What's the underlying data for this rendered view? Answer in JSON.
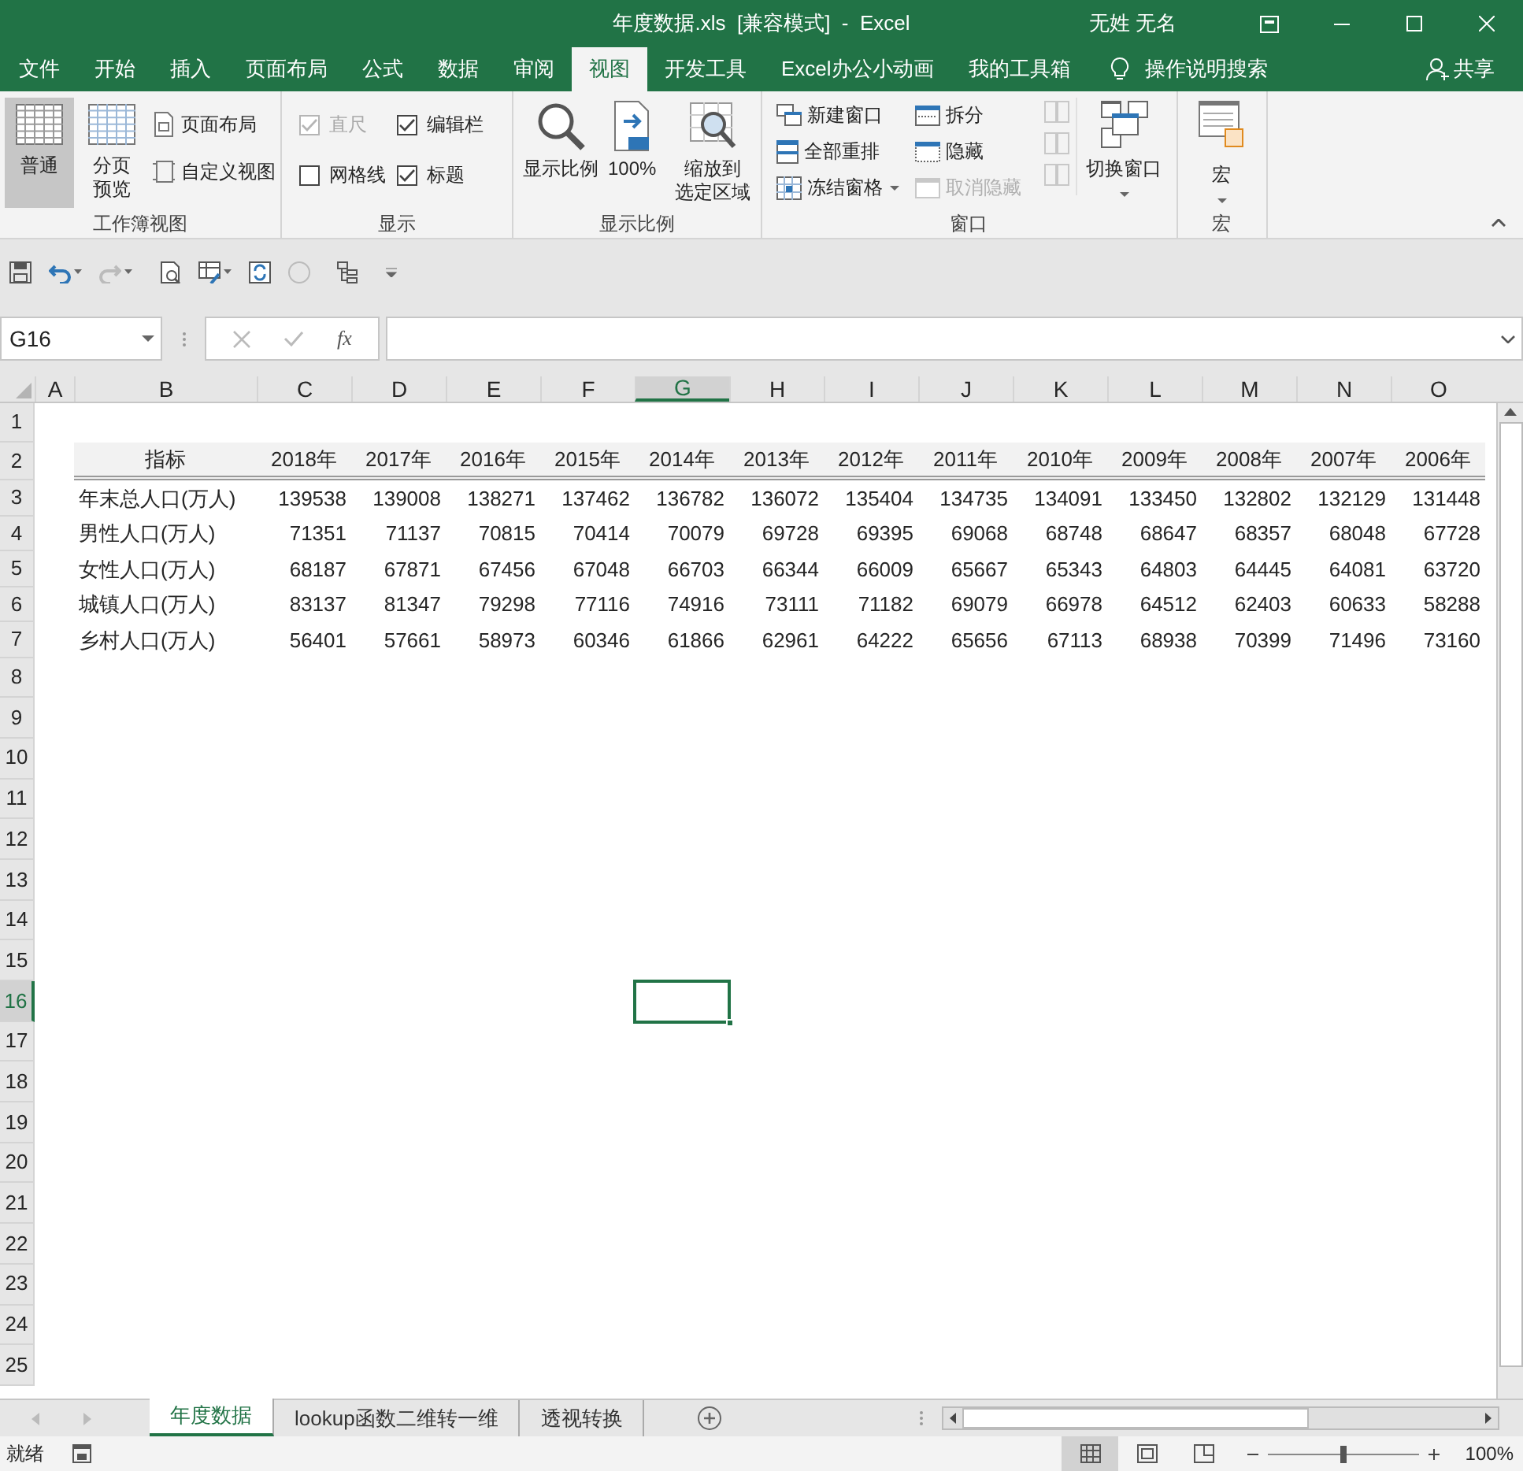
{
  "window": {
    "title": "年度数据.xls  [兼容模式]  -  Excel",
    "user": "无姓 无名"
  },
  "ribbon_tabs": [
    {
      "label": "文件",
      "selected": false
    },
    {
      "label": "开始",
      "selected": false
    },
    {
      "label": "插入",
      "selected": false
    },
    {
      "label": "页面布局",
      "selected": false
    },
    {
      "label": "公式",
      "selected": false
    },
    {
      "label": "数据",
      "selected": false
    },
    {
      "label": "审阅",
      "selected": false
    },
    {
      "label": "视图",
      "selected": true
    },
    {
      "label": "开发工具",
      "selected": false
    },
    {
      "label": "Excel办公小动画",
      "selected": false
    },
    {
      "label": "我的工具箱",
      "selected": false
    }
  ],
  "tell_me": "操作说明搜索",
  "share": "共享",
  "ribbon": {
    "workbook_views": {
      "label": "工作簿视图",
      "large": [
        {
          "lines": [
            "普通"
          ],
          "selected": true
        },
        {
          "lines": [
            "分页",
            "预览"
          ],
          "selected": false
        }
      ],
      "small": [
        "页面布局",
        "自定义视图"
      ]
    },
    "show": {
      "label": "显示",
      "checkboxes": [
        {
          "label": "直尺",
          "checked": true,
          "disabled": true
        },
        {
          "label": "编辑栏",
          "checked": true,
          "disabled": false
        },
        {
          "label": "网格线",
          "checked": false,
          "disabled": false
        },
        {
          "label": "标题",
          "checked": true,
          "disabled": false
        }
      ]
    },
    "zoom": {
      "label": "显示比例",
      "buttons": [
        {
          "kind": "magnifier",
          "lines": [
            "显示比例"
          ]
        },
        {
          "kind": "hundred",
          "lines": [
            "100%"
          ]
        },
        {
          "kind": "selection",
          "lines": [
            "缩放到",
            "选定区域"
          ]
        }
      ]
    },
    "window": {
      "label": "窗口",
      "items": [
        {
          "kind": "new",
          "label": "新建窗口",
          "disabled": false
        },
        {
          "kind": "arrange",
          "label": "全部重排",
          "disabled": false
        },
        {
          "kind": "freeze",
          "label": "冻结窗格",
          "disabled": false
        },
        {
          "kind": "split",
          "label": "拆分",
          "disabled": false
        },
        {
          "kind": "hide",
          "label": "隐藏",
          "disabled": false
        },
        {
          "kind": "unhide",
          "label": "取消隐藏",
          "disabled": true
        }
      ],
      "switch": "切换窗口"
    },
    "macros": {
      "label": "宏",
      "button": "宏"
    }
  },
  "name_box": "G16",
  "formula_bar": {
    "function_label": "fx"
  },
  "columns": [
    {
      "label": "A",
      "selected": false
    },
    {
      "label": "B",
      "selected": false
    },
    {
      "label": "C",
      "selected": false
    },
    {
      "label": "D",
      "selected": false
    },
    {
      "label": "E",
      "selected": false
    },
    {
      "label": "F",
      "selected": false
    },
    {
      "label": "G",
      "selected": true
    },
    {
      "label": "H",
      "selected": false
    },
    {
      "label": "I",
      "selected": false
    },
    {
      "label": "J",
      "selected": false
    },
    {
      "label": "K",
      "selected": false
    },
    {
      "label": "L",
      "selected": false
    },
    {
      "label": "M",
      "selected": false
    },
    {
      "label": "N",
      "selected": false
    },
    {
      "label": "O",
      "selected": false
    }
  ],
  "rows": [
    {
      "label": "1",
      "selected": false
    },
    {
      "label": "2",
      "selected": false
    },
    {
      "label": "3",
      "selected": false
    },
    {
      "label": "4",
      "selected": false
    },
    {
      "label": "5",
      "selected": false
    },
    {
      "label": "6",
      "selected": false
    },
    {
      "label": "7",
      "selected": false
    },
    {
      "label": "8",
      "selected": false
    },
    {
      "label": "9",
      "selected": false
    },
    {
      "label": "10",
      "selected": false
    },
    {
      "label": "11",
      "selected": false
    },
    {
      "label": "12",
      "selected": false
    },
    {
      "label": "13",
      "selected": false
    },
    {
      "label": "14",
      "selected": false
    },
    {
      "label": "15",
      "selected": false
    },
    {
      "label": "16",
      "selected": true
    },
    {
      "label": "17",
      "selected": false
    },
    {
      "label": "18",
      "selected": false
    },
    {
      "label": "19",
      "selected": false
    },
    {
      "label": "20",
      "selected": false
    },
    {
      "label": "21",
      "selected": false
    },
    {
      "label": "22",
      "selected": false
    },
    {
      "label": "23",
      "selected": false
    },
    {
      "label": "24",
      "selected": false
    },
    {
      "label": "25",
      "selected": false
    }
  ],
  "table": {
    "header": [
      "指标",
      "2018年",
      "2017年",
      "2016年",
      "2015年",
      "2014年",
      "2013年",
      "2012年",
      "2011年",
      "2010年",
      "2009年",
      "2008年",
      "2007年",
      "2006年"
    ],
    "rows": [
      [
        "年末总人口(万人)",
        "139538",
        "139008",
        "138271",
        "137462",
        "136782",
        "136072",
        "135404",
        "134735",
        "134091",
        "133450",
        "132802",
        "132129",
        "131448"
      ],
      [
        "男性人口(万人)",
        "71351",
        "71137",
        "70815",
        "70414",
        "70079",
        "69728",
        "69395",
        "69068",
        "68748",
        "68647",
        "68357",
        "68048",
        "67728"
      ],
      [
        "女性人口(万人)",
        "68187",
        "67871",
        "67456",
        "67048",
        "66703",
        "66344",
        "66009",
        "65667",
        "65343",
        "64803",
        "64445",
        "64081",
        "63720"
      ],
      [
        "城镇人口(万人)",
        "83137",
        "81347",
        "79298",
        "77116",
        "74916",
        "73111",
        "71182",
        "69079",
        "66978",
        "64512",
        "62403",
        "60633",
        "58288"
      ],
      [
        "乡村人口(万人)",
        "56401",
        "57661",
        "58973",
        "60346",
        "61866",
        "62961",
        "64222",
        "65656",
        "67113",
        "68938",
        "70399",
        "71496",
        "73160"
      ]
    ]
  },
  "sheet_tabs": [
    {
      "label": "年度数据",
      "selected": true
    },
    {
      "label": "lookup函数二维转一维",
      "selected": false
    },
    {
      "label": "透视转换",
      "selected": false
    }
  ],
  "status_bar": {
    "status": "就绪",
    "zoom": "100%",
    "zoom_level": {
      "level": 0.5
    }
  }
}
